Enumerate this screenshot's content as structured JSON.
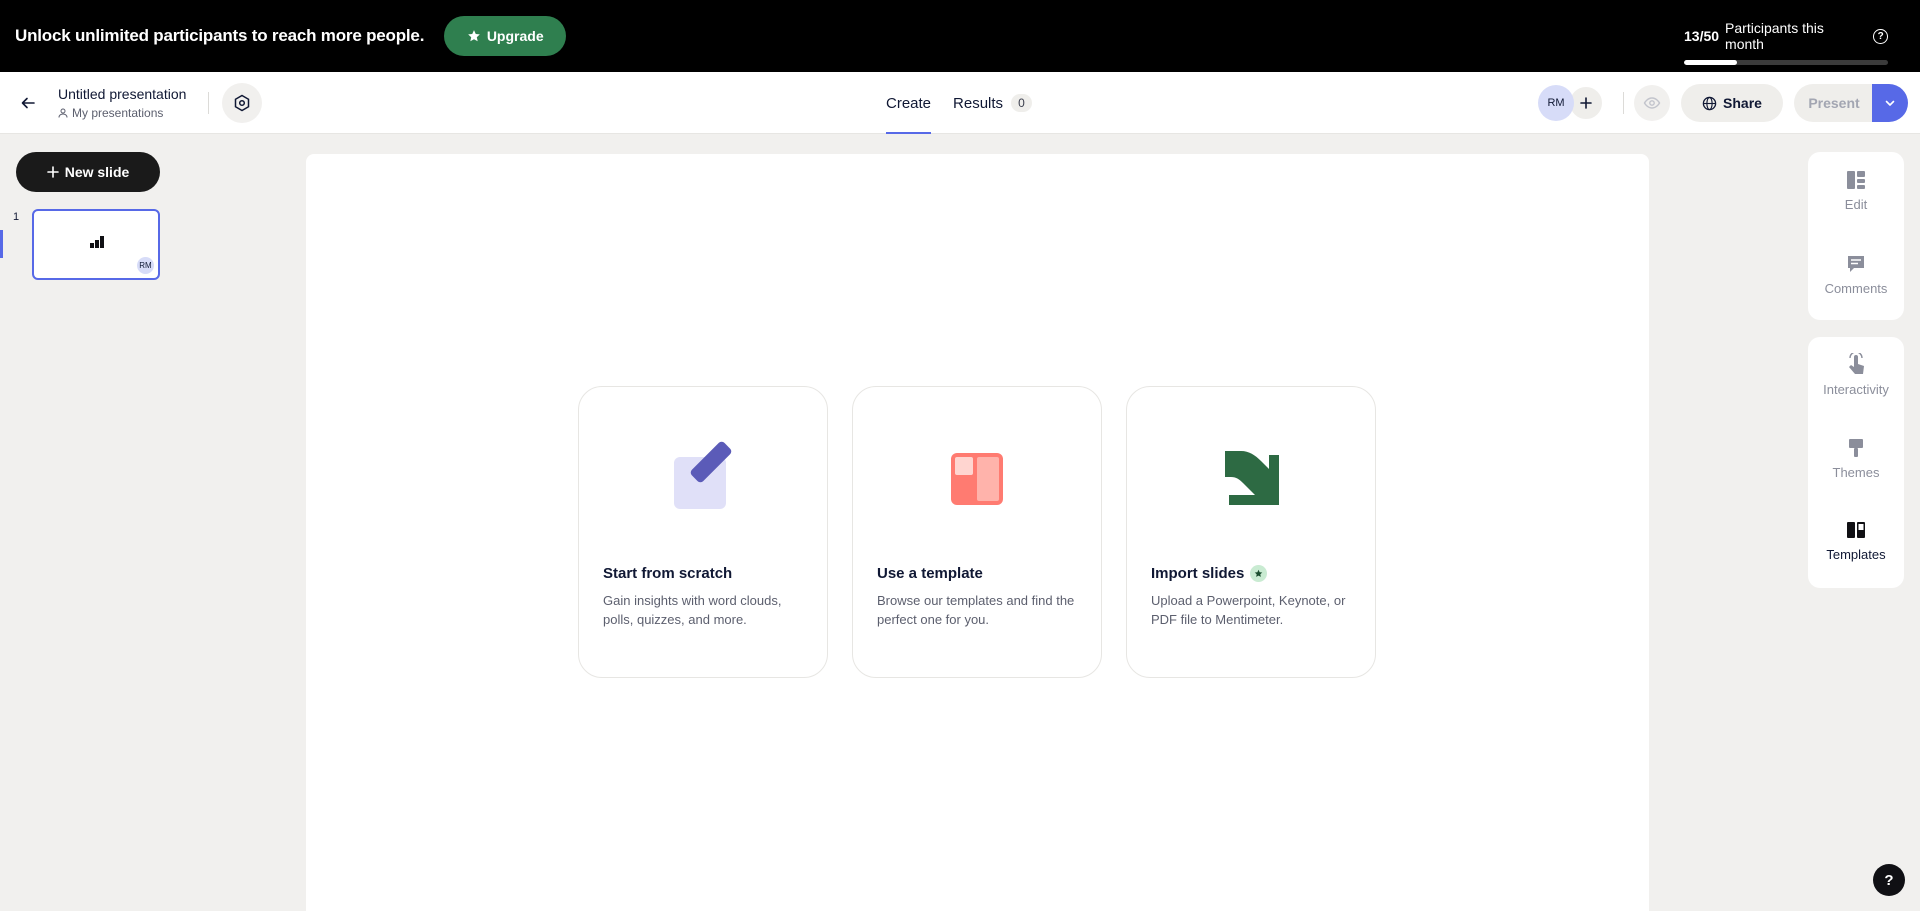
{
  "banner": {
    "text": "Unlock unlimited participants to reach more people.",
    "upgrade_label": "Upgrade",
    "participants_count": "13/50",
    "participants_label": "Participants this month",
    "participants_progress": 0.26,
    "help_glyph": "?"
  },
  "header": {
    "title": "Untitled presentation",
    "folder": "My presentations",
    "tabs": [
      {
        "label": "Create",
        "active": true
      },
      {
        "label": "Results",
        "badge": "0"
      }
    ],
    "avatar_initials": "RM",
    "share_label": "Share",
    "present_label": "Present"
  },
  "left_panel": {
    "new_slide_label": "New slide",
    "slides": [
      {
        "number": "1",
        "avatar": "RM"
      }
    ]
  },
  "main": {
    "cards": [
      {
        "title": "Start from scratch",
        "description": "Gain insights with word clouds, polls, quizzes, and more.",
        "icon": "pencil-square-icon"
      },
      {
        "title": "Use a template",
        "description": "Browse our templates and find the perfect one for you.",
        "icon": "template-icon"
      },
      {
        "title": "Import slides",
        "description": "Upload a Powerpoint, Keynote, or PDF file to Mentimeter.",
        "icon": "import-arrow-icon",
        "premium": true
      }
    ]
  },
  "right_panel": {
    "items": [
      {
        "label": "Edit",
        "icon": "edit-icon"
      },
      {
        "label": "Comments",
        "icon": "comments-icon"
      },
      {
        "label": "Interactivity",
        "icon": "interactivity-icon"
      },
      {
        "label": "Themes",
        "icon": "themes-icon"
      },
      {
        "label": "Templates",
        "icon": "templates-icon",
        "active": true
      }
    ]
  },
  "help_fab": "?",
  "colors": {
    "accent": "#5769e7",
    "upgrade_green": "#2f7f4f",
    "import_green": "#2d6a43",
    "template_red": "#ff7b71",
    "scratch_purple": "#5b5bb8"
  }
}
